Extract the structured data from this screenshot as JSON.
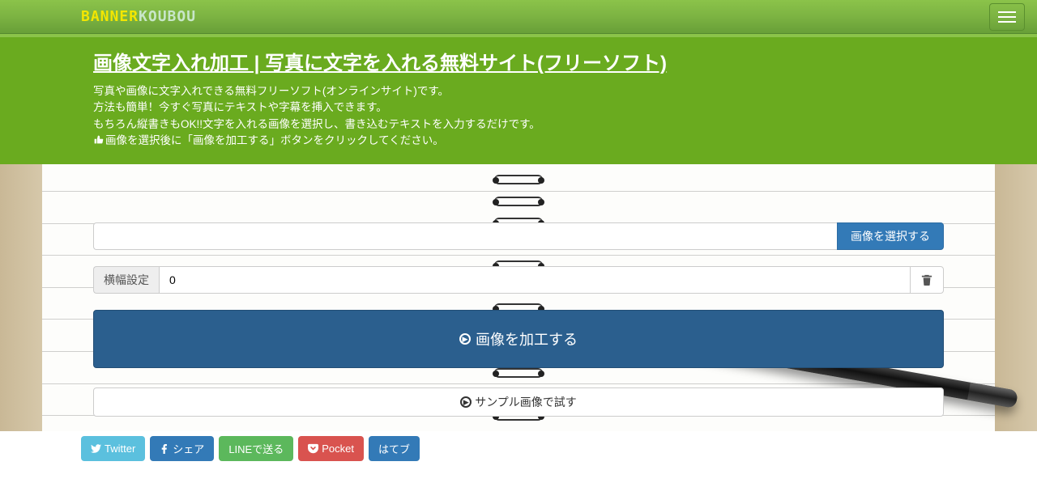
{
  "navbar": {
    "logo_part1": "BANNER",
    "logo_part2": "KOUBOU"
  },
  "hero": {
    "title": "画像文字入れ加工 | 写真に文字を入れる無料サイト(フリーソフト)",
    "line1": "写真や画像に文字入れできる無料フリーソフト(オンラインサイト)です。",
    "line2": "方法も簡単！今すぐ写真にテキストや字幕を挿入できます。",
    "line3": "もちろん縦書きもOK!!文字を入れる画像を選択し、書き込むテキストを入力するだけです。",
    "line4": "画像を選択後に「画像を加工する」ボタンをクリックしてください。"
  },
  "form": {
    "select_image_label": "画像を選択する",
    "width_label": "横幅設定",
    "width_value": "0",
    "process_button": "画像を加工する",
    "sample_button": "サンプル画像で試す"
  },
  "share": {
    "twitter": "Twitter",
    "facebook": "シェア",
    "line": "LINEで送る",
    "pocket": "Pocket",
    "hatena": "はてブ"
  }
}
